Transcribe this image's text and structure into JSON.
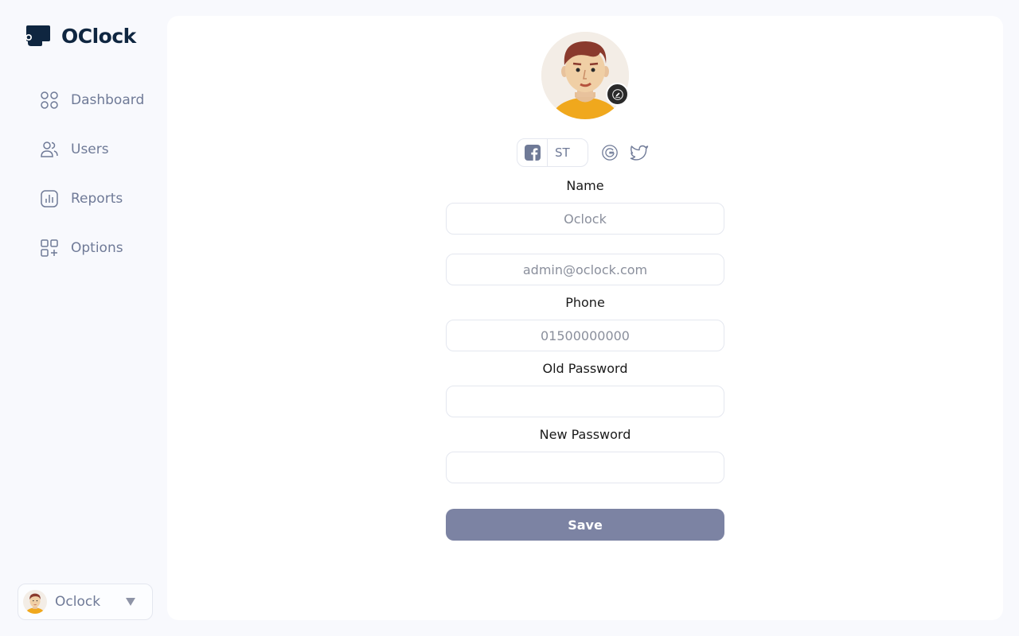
{
  "brand": {
    "name": "OClock",
    "logo_icon": "clock-logo-icon"
  },
  "sidebar": {
    "items": [
      {
        "label": "Dashboard",
        "icon": "grid-icon"
      },
      {
        "label": "Users",
        "icon": "users-icon"
      },
      {
        "label": "Reports",
        "icon": "reports-icon"
      },
      {
        "label": "Options",
        "icon": "options-icon"
      }
    ]
  },
  "user_menu": {
    "name": "Oclock",
    "icon": "chevron-down-icon"
  },
  "profile": {
    "edit_icon": "pencil-icon",
    "social": {
      "facebook_icon": "facebook-icon",
      "initials": "ST",
      "google_icon": "google-icon",
      "twitter_icon": "twitter-icon"
    },
    "name_label": "Name",
    "name_placeholder": "Oclock",
    "email_placeholder": "admin@oclock.com",
    "phone_label": "Phone",
    "phone_placeholder": "01500000000",
    "old_password_label": "Old Password",
    "new_password_label": "New Password",
    "save_label": "Save"
  },
  "colors": {
    "brand_dark": "#0f2640",
    "nav_text": "#6f7a97",
    "button": "#7c83a3",
    "background": "#f8f9fd"
  }
}
